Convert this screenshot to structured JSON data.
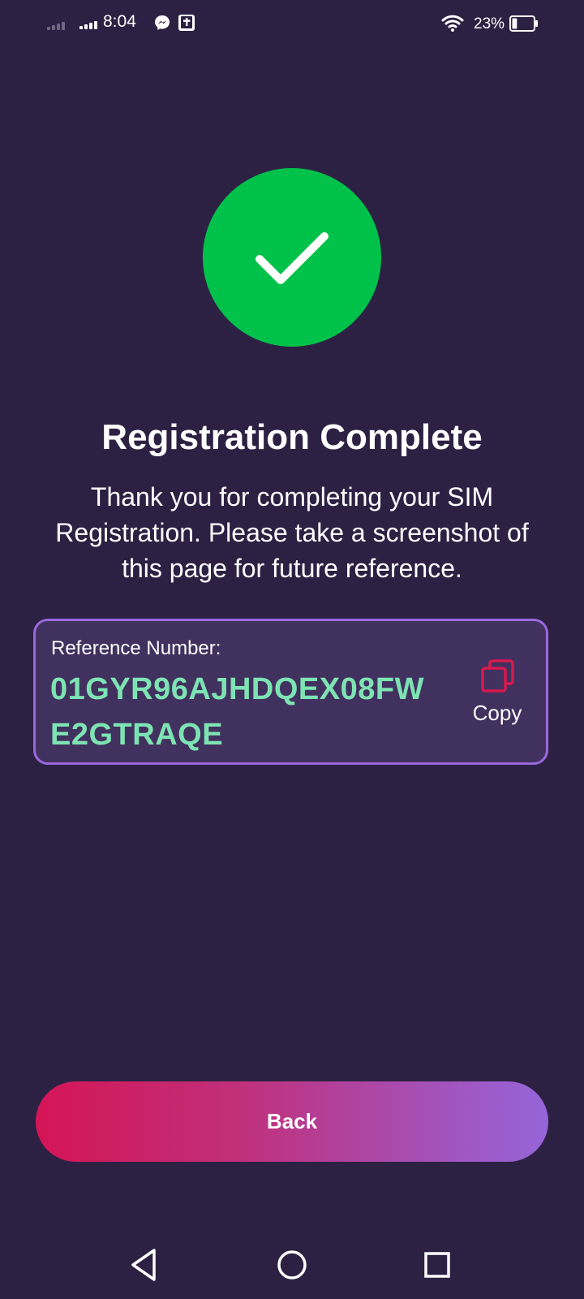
{
  "status_bar": {
    "time": "8:04",
    "battery_percent": "23%",
    "battery_level": 0.23,
    "icons": [
      "signal-icon",
      "signal-icon",
      "messenger-icon",
      "bible-app-icon",
      "wifi-icon",
      "battery-icon"
    ]
  },
  "success": {
    "icon": "checkmark-icon",
    "color": "#00c24a"
  },
  "title": "Registration Complete",
  "message": "Thank you for completing your SIM Registration. Please take a screenshot of this page for future reference.",
  "reference": {
    "label": "Reference Number:",
    "number": "01GYR96AJHDQEX08FWE2GTRAQE",
    "copy_label": "Copy",
    "copy_icon": "copy-icon",
    "accent_color": "#7ee3b3",
    "border_color": "#9a67dd"
  },
  "back_button": {
    "label": "Back",
    "gradient": [
      "#d51556",
      "#9565d9"
    ]
  },
  "navigation": {
    "icons": [
      "back-triangle-icon",
      "home-circle-icon",
      "recents-square-icon"
    ]
  },
  "colors": {
    "background": "#2d2143",
    "copy_icon": "#d8194f"
  }
}
